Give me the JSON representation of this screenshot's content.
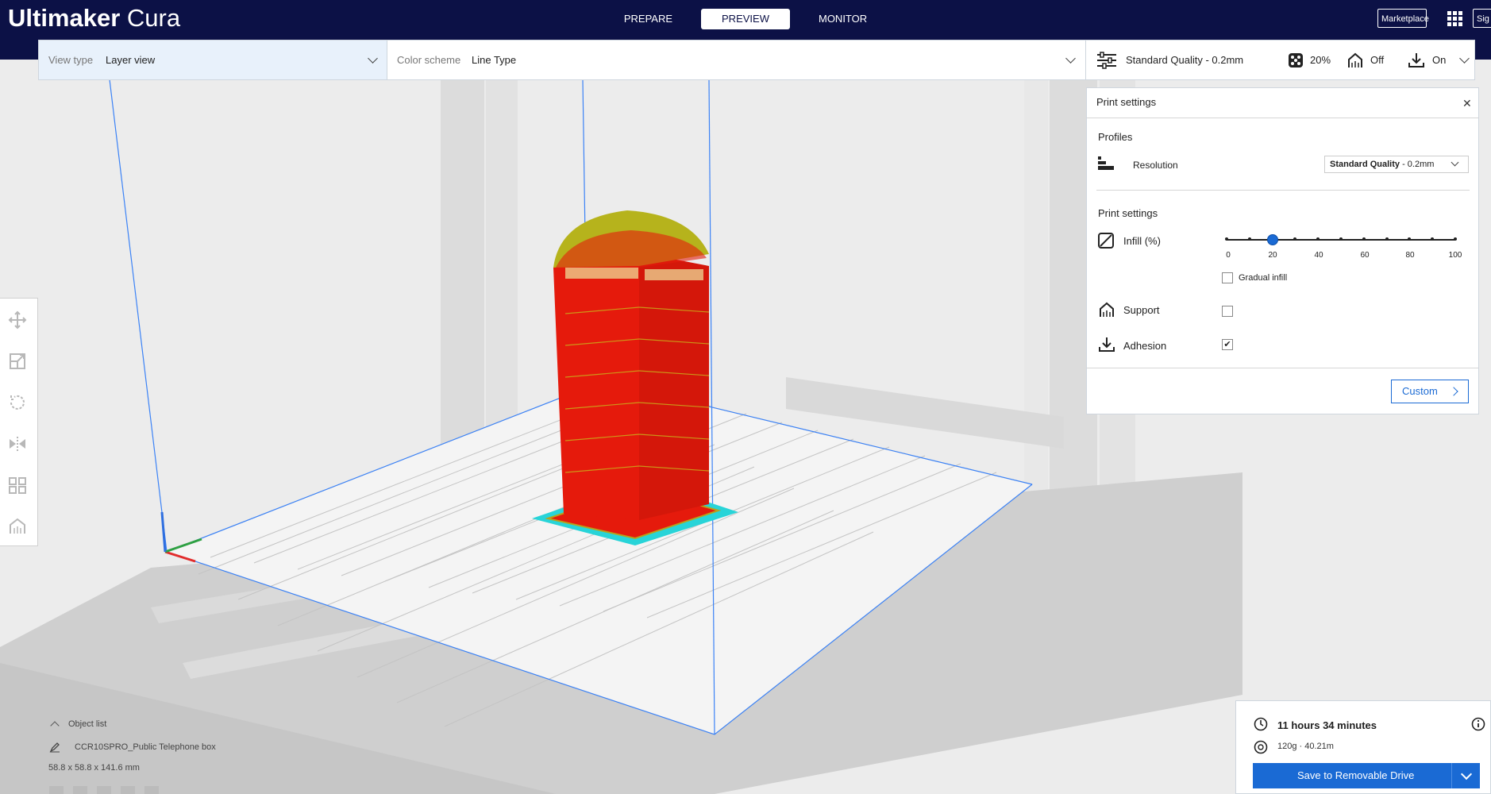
{
  "app": {
    "title_bold": "Ultimaker",
    "title_light": "Cura"
  },
  "stages": [
    {
      "label": "PREPARE",
      "active": false
    },
    {
      "label": "PREVIEW",
      "active": true
    },
    {
      "label": "MONITOR",
      "active": false
    }
  ],
  "header": {
    "marketplace_label": "Marketplace",
    "sign_in_label": "Sig"
  },
  "view_type": {
    "label": "View type",
    "value": "Layer view"
  },
  "color_scheme": {
    "label": "Color scheme",
    "value": "Line Type"
  },
  "print_summary": {
    "profile": "Standard Quality - 0.2mm",
    "infill": "20%",
    "support": "Off",
    "adhesion": "On"
  },
  "print_settings": {
    "title": "Print settings",
    "profiles_heading": "Profiles",
    "resolution_label": "Resolution",
    "resolution_value_bold": "Standard Quality",
    "resolution_value_rest": " - 0.2mm",
    "settings_heading": "Print settings",
    "infill_label": "Infill (%)",
    "infill_value": 20,
    "infill_ticks": [
      "0",
      "20",
      "40",
      "60",
      "80",
      "100"
    ],
    "gradual_infill_label": "Gradual infill",
    "support_label": "Support",
    "support_checked": false,
    "adhesion_label": "Adhesion",
    "adhesion_checked": true,
    "custom_label": "Custom"
  },
  "object_list": {
    "label": "Object list",
    "object_name": "CCR10SPRO_Public Telephone box",
    "dimensions": "58.8 x 58.8 x 141.6 mm"
  },
  "job": {
    "time": "11 hours 34 minutes",
    "material": "120g · 40.21m",
    "save_label": "Save to Removable Drive"
  },
  "colors": {
    "header_bg": "#0c1146",
    "accent": "#1a6ad4",
    "model_wall": "#e51a0c",
    "model_infill": "#d6c21e",
    "skirt": "#28d4d8"
  }
}
